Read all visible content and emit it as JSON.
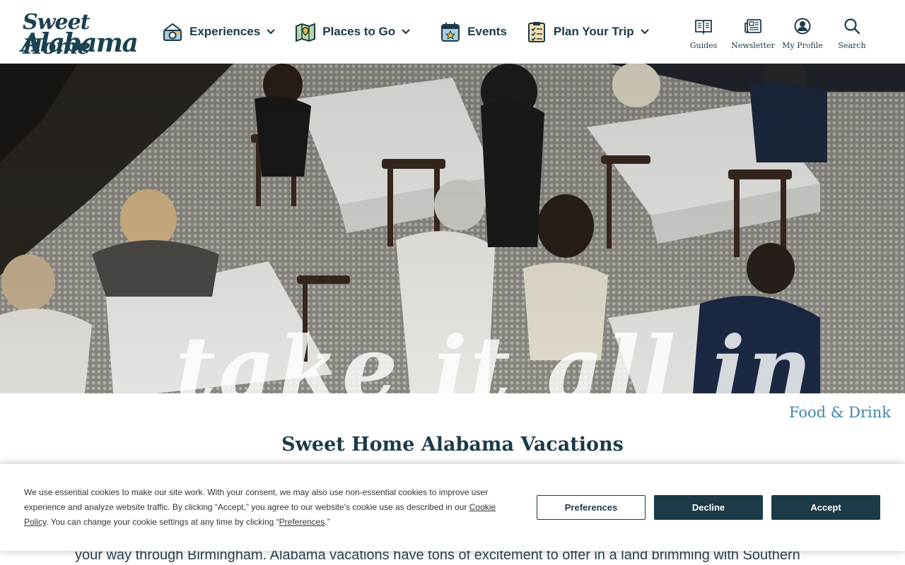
{
  "logo": {
    "line1": "Sweet Home",
    "line2": "Alabama"
  },
  "nav": [
    {
      "label": "Experiences",
      "icon": "camera-icon",
      "has_dropdown": true
    },
    {
      "label": "Places to Go",
      "icon": "map-icon",
      "has_dropdown": true
    },
    {
      "label": "Events",
      "icon": "calendar-icon",
      "has_dropdown": false
    },
    {
      "label": "Plan Your Trip",
      "icon": "checklist-icon",
      "has_dropdown": true
    }
  ],
  "utility": [
    {
      "label": "Guides",
      "icon": "book-icon"
    },
    {
      "label": "Newsletter",
      "icon": "newspaper-icon"
    },
    {
      "label": "My Profile",
      "icon": "user-icon"
    },
    {
      "label": "Search",
      "icon": "search-icon"
    }
  ],
  "hero": {
    "tagline": "take it all in",
    "image": "restaurant-dining-photo"
  },
  "category_link": "Food & Drink",
  "page_title": "Sweet Home Alabama Vacations",
  "body_partial": "your way through Birmingham. Alabama vacations have tons of excitement to offer in a land brimming with Southern",
  "cookie": {
    "text_a": "We use essential cookies to make our site work. With your consent, we may also use non-essential cookies to improve user experience and analyze website traffic. By clicking “Accept,” you agree to our website's cookie use as described in our ",
    "link_policy": "Cookie Policy",
    "text_b": ". You can change your cookie settings at any time by clicking “",
    "link_prefs": "Preferences",
    "text_c": ".”",
    "preferences_label": "Preferences",
    "decline_label": "Decline",
    "accept_label": "Accept"
  },
  "colors": {
    "brand": "#1c3a47",
    "link": "#3f86ad",
    "text": "#1d3a48"
  }
}
